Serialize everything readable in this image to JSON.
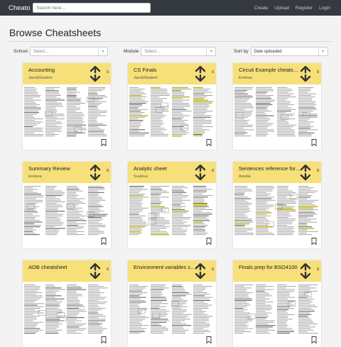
{
  "app": {
    "brand": "Cheato"
  },
  "search": {
    "placeholder": "Search here..."
  },
  "nav": {
    "create": "Create",
    "upload": "Upload",
    "register": "Register",
    "login": "Login"
  },
  "page": {
    "title": "Browse Cheatsheets"
  },
  "filters": {
    "school_label": "School",
    "school_placeholder": "Select...",
    "module_label": "Module",
    "module_placeholder": "Select...",
    "sort_label": "Sort by",
    "sort_value": "Date uploaded"
  },
  "cards": [
    {
      "title": "Accounting",
      "author": "JacobStudent",
      "votes": "0",
      "highlight": false
    },
    {
      "title": "CS Finals",
      "author": "JacobStudent",
      "votes": "0",
      "highlight": true
    },
    {
      "title": "Circuit Example cheatsheet",
      "author": "Ereleva",
      "votes": "0",
      "highlight": false
    },
    {
      "title": "Summary Review",
      "author": "Ereleva",
      "votes": "0",
      "highlight": false
    },
    {
      "title": "Analytic sheet",
      "author": "Suatnus",
      "votes": "0",
      "highlight": true
    },
    {
      "title": "Sentences reference for exam",
      "author": "Amelia",
      "votes": "0",
      "highlight": true
    },
    {
      "title": "AOB cheatsheet",
      "author": "",
      "votes": "0",
      "highlight": false
    },
    {
      "title": "Environment variables summary",
      "author": "",
      "votes": "0",
      "highlight": false
    },
    {
      "title": "Finals prep for BSO4100",
      "author": "",
      "votes": "0",
      "highlight": false
    }
  ],
  "colors": {
    "navbar": "#343a40",
    "card_header": "#f7e07a",
    "highlight": "#f2e600"
  }
}
